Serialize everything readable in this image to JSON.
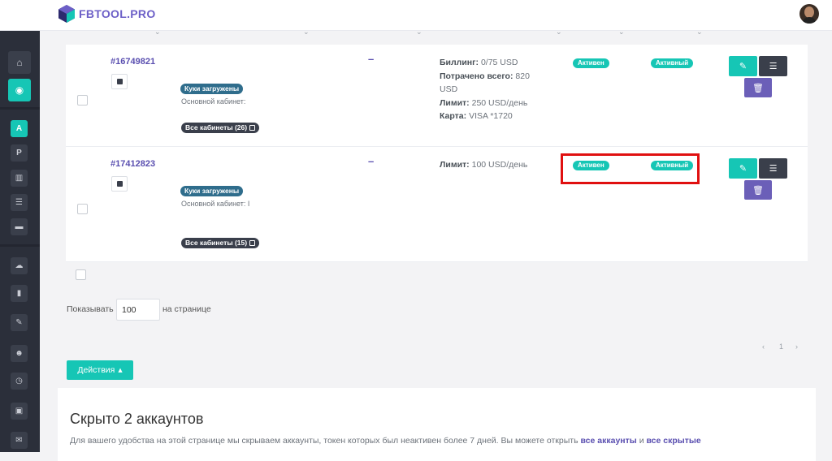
{
  "app": {
    "logo_text": "FBTOOL.PRO"
  },
  "sidebar": {
    "items": [
      {
        "icon": "home-icon"
      },
      {
        "icon": "user-circle-icon",
        "active": true
      },
      {
        "label": "A",
        "active": true
      },
      {
        "label": "P"
      },
      {
        "icon": "columns-icon"
      },
      {
        "icon": "list-icon"
      },
      {
        "icon": "folder-icon"
      },
      {
        "icon": "cloud-upload-icon"
      },
      {
        "icon": "bar-chart-icon"
      },
      {
        "icon": "edit-icon"
      },
      {
        "icon": "users-icon"
      },
      {
        "icon": "clock-icon"
      },
      {
        "icon": "money-icon"
      },
      {
        "icon": "chat-icon"
      }
    ]
  },
  "rows": [
    {
      "id": "#16749821",
      "cookie_badge": "Куки загружены",
      "cabinet_label": "Основной кабинет:",
      "cabinet_value": "",
      "all_cabinets": "Все кабинеты (26)",
      "dash": "–",
      "billing_label": "Биллинг:",
      "billing_value": "0/75 USD",
      "spent_label": "Потрачено всего:",
      "spent_value": "820",
      "spent_unit": "USD",
      "limit_label": "Лимит:",
      "limit_value": "250 USD/день",
      "card_label": "Карта:",
      "card_value": "VISA *1720",
      "status1": "Активен",
      "status2": "Активный"
    },
    {
      "id": "#17412823",
      "cookie_badge": "Куки загружены",
      "cabinet_label": "Основной кабинет:",
      "cabinet_value": "I",
      "all_cabinets": "Все кабинеты (15)",
      "dash": "–",
      "limit_label": "Лимит:",
      "limit_value": "100 USD/день",
      "status1": "Активен",
      "status2": "Активный"
    }
  ],
  "pagination": {
    "show_label": "Показывать",
    "per_page": "100",
    "per_page_suffix": "на странице",
    "prev": "‹",
    "current": "1",
    "next": "›"
  },
  "actions_button": "Действия",
  "hidden_notice": {
    "title": "Скрыто 2 аккаунтов",
    "text": "Для вашего удобства на этой странице мы скрываем аккаунты, токен которых был неактивен более 7 дней. Вы можете открыть",
    "link_all": "все аккаунты",
    "and": "и",
    "link_hidden": "все скрытые"
  },
  "colors": {
    "accent": "#16c6b5",
    "brand": "#6c5fc7",
    "sidebar": "#2b2f3a",
    "highlight": "#e01010"
  }
}
